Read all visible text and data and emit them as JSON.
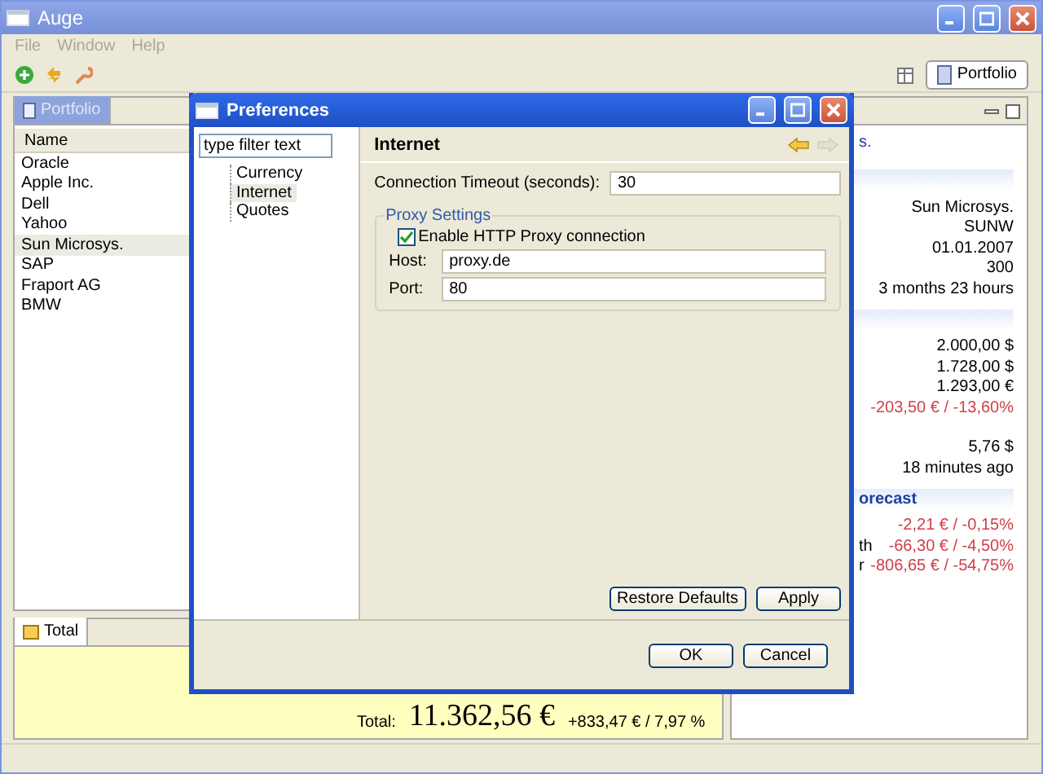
{
  "window": {
    "title": "Auge"
  },
  "menu": [
    {
      "label": "File",
      "disabled": true
    },
    {
      "label": "Window",
      "disabled": true
    },
    {
      "label": "Help",
      "disabled": true
    }
  ],
  "perspective": {
    "label": "Portfolio",
    "selected": true
  },
  "portfolio_view": {
    "tab": {
      "label": "Portfolio",
      "selected": true
    },
    "columns": [
      "Name"
    ],
    "rows": [
      {
        "name": "Oracle",
        "selected": false
      },
      {
        "name": "Apple Inc.",
        "selected": false
      },
      {
        "name": "Dell",
        "selected": false
      },
      {
        "name": "Yahoo",
        "selected": false
      },
      {
        "name": "Sun Microsys.",
        "selected": true
      },
      {
        "name": "SAP",
        "selected": false
      },
      {
        "name": "Fraport AG",
        "selected": false
      },
      {
        "name": "BMW",
        "selected": false
      }
    ]
  },
  "total_view": {
    "tab": {
      "label": "Total",
      "selected": true
    },
    "label": "Total:",
    "amount": "11.362,56 €",
    "change": "+833,47 € / 7,97 %"
  },
  "details_view": {
    "header_fragment": "s.",
    "sections": [
      {
        "rows": [
          {
            "value": "Sun Microsys.",
            "negative": false
          },
          {
            "value": "SUNW",
            "negative": false
          },
          {
            "value": "01.01.2007",
            "negative": false
          },
          {
            "value": "300",
            "negative": false
          },
          {
            "value": "3 months 23 hours",
            "negative": false
          }
        ]
      },
      {
        "rows": [
          {
            "value": "2.000,00 $",
            "negative": false
          },
          {
            "value": "1.728,00 $",
            "negative": false
          },
          {
            "value": "1.293,00 €",
            "negative": false
          },
          {
            "value": "-203,50 € / -13,60%",
            "negative": true
          },
          {
            "value": "5,76 $",
            "negative": false
          },
          {
            "value": "18 minutes ago",
            "negative": false
          }
        ]
      },
      {
        "title": "orecast",
        "rows": [
          {
            "value": "-2,21 € / -0,15%",
            "negative": true
          },
          {
            "label": "th",
            "value": "-66,30 € / -4,50%",
            "negative": true
          },
          {
            "label": "r",
            "value": "-806,65 € / -54,75%",
            "negative": true
          }
        ]
      }
    ]
  },
  "dialog": {
    "title": "Preferences",
    "filter": {
      "placeholder": "type filter text"
    },
    "tree": [
      {
        "label": "Currency",
        "selected": false
      },
      {
        "label": "Internet",
        "selected": true
      },
      {
        "label": "Quotes",
        "selected": false
      }
    ],
    "navigation": [
      {
        "kind": "back",
        "disabled": false
      },
      {
        "kind": "forward",
        "disabled": true
      }
    ],
    "page": {
      "title": "Internet",
      "fields": [
        {
          "label": "Connection Timeout (seconds):",
          "value": "30"
        }
      ],
      "group": {
        "title": "Proxy Settings",
        "checkbox": {
          "label": "Enable HTTP Proxy connection",
          "checked": true
        },
        "fields": [
          {
            "label": "Host:",
            "value": "proxy.de"
          },
          {
            "label": "Port:",
            "value": "80"
          }
        ]
      }
    },
    "page_buttons": [
      "Restore Defaults",
      "Apply"
    ],
    "buttons": [
      "OK",
      "Cancel"
    ]
  }
}
